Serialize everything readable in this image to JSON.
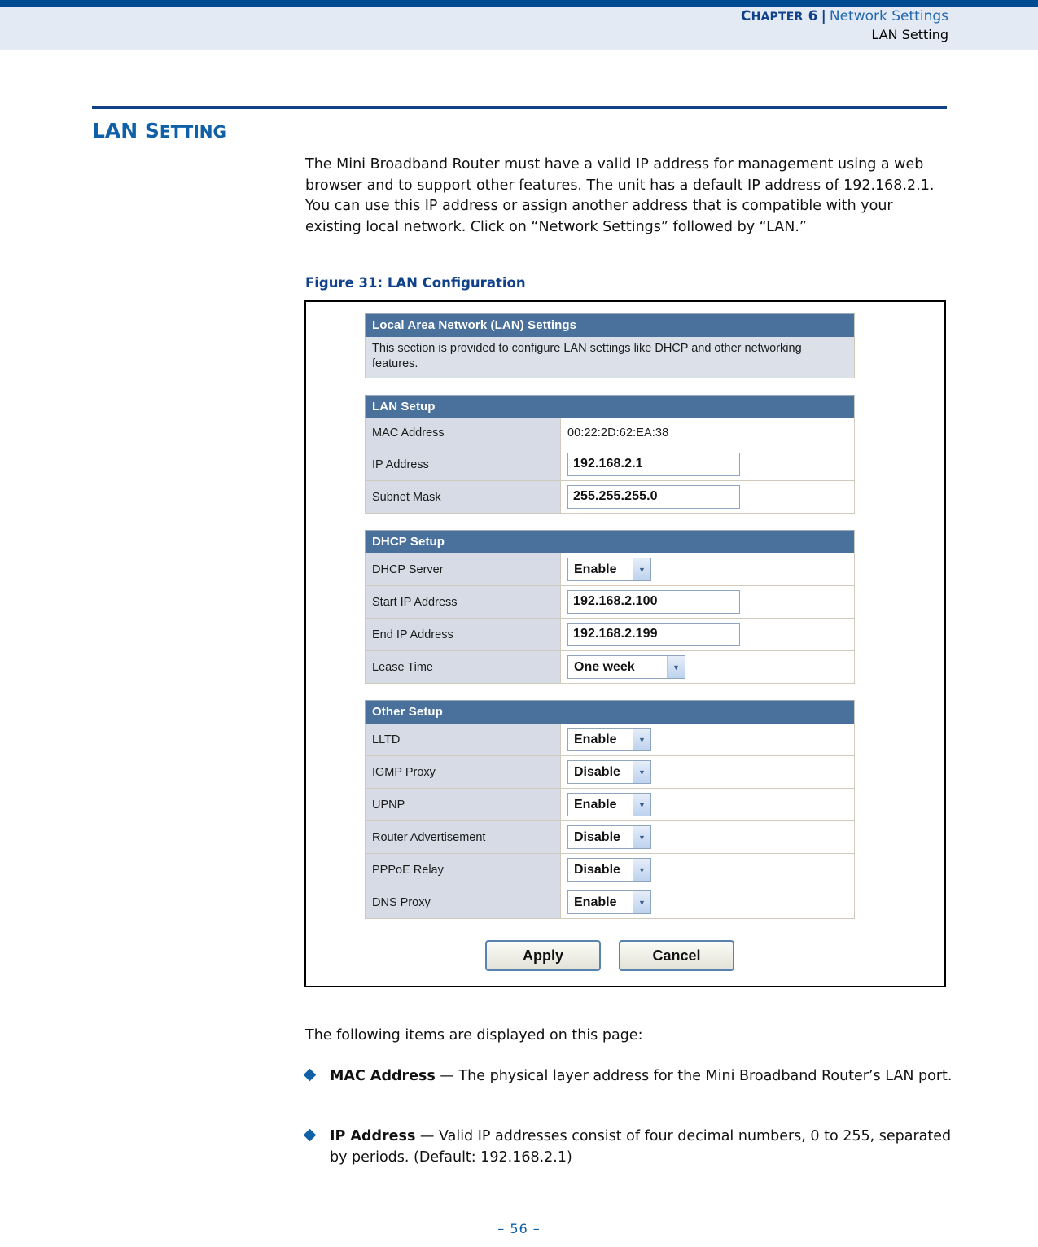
{
  "header": {
    "chapter_label": "Chapter 6",
    "separator": "|",
    "section": "Network Settings",
    "subsection": "LAN Setting"
  },
  "section": {
    "title": "LAN Setting",
    "intro": "The Mini Broadband Router must have a valid IP address for management using a web browser and to support other features. The unit has a default IP address of 192.168.2.1. You can use this IP address or assign another address that is compatible with your existing local network. Click on “Network Settings” followed by “LAN.”"
  },
  "figure": {
    "caption": "Figure 31:  LAN Configuration",
    "ui": {
      "overview": {
        "title": "Local Area Network (LAN) Settings",
        "description": "This section is provided to configure LAN settings like DHCP and other networking features."
      },
      "panels": [
        {
          "title": "LAN Setup",
          "rows": [
            {
              "label": "MAC Address",
              "type": "static",
              "value": "00:22:2D:62:EA:38"
            },
            {
              "label": "IP Address",
              "type": "text",
              "value": "192.168.2.1"
            },
            {
              "label": "Subnet Mask",
              "type": "text",
              "value": "255.255.255.0"
            }
          ]
        },
        {
          "title": "DHCP Setup",
          "rows": [
            {
              "label": "DHCP Server",
              "type": "select",
              "value": "Enable"
            },
            {
              "label": "Start IP Address",
              "type": "text",
              "value": "192.168.2.100"
            },
            {
              "label": "End IP Address",
              "type": "text",
              "value": "192.168.2.199"
            },
            {
              "label": "Lease Time",
              "type": "select-wide",
              "value": "One week"
            }
          ]
        },
        {
          "title": "Other Setup",
          "rows": [
            {
              "label": "LLTD",
              "type": "select",
              "value": "Enable"
            },
            {
              "label": "IGMP Proxy",
              "type": "select",
              "value": "Disable"
            },
            {
              "label": "UPNP",
              "type": "select",
              "value": "Enable"
            },
            {
              "label": "Router Advertisement",
              "type": "select",
              "value": "Disable"
            },
            {
              "label": "PPPoE Relay",
              "type": "select",
              "value": "Disable"
            },
            {
              "label": "DNS Proxy",
              "type": "select",
              "value": "Enable"
            }
          ]
        }
      ],
      "buttons": {
        "apply": "Apply",
        "cancel": "Cancel"
      }
    }
  },
  "following": {
    "lead": "The following items are displayed on this page:",
    "items": [
      {
        "term": "MAC Address",
        "dash": " — ",
        "desc": "The physical layer address for the Mini Broadband Router’s LAN port."
      },
      {
        "term": "IP Address",
        "dash": " — ",
        "desc": "Valid IP addresses consist of four decimal numbers, 0 to 255, separated by periods. (Default: 192.168.2.1)"
      }
    ]
  },
  "footer": {
    "page": "–  56  –"
  },
  "colors": {
    "brand_blue": "#004b91",
    "heading_blue": "#1060a8",
    "header_band": "#e4eaf3",
    "panel_title": "#4a719c",
    "label_cell": "#d6dbe6"
  }
}
